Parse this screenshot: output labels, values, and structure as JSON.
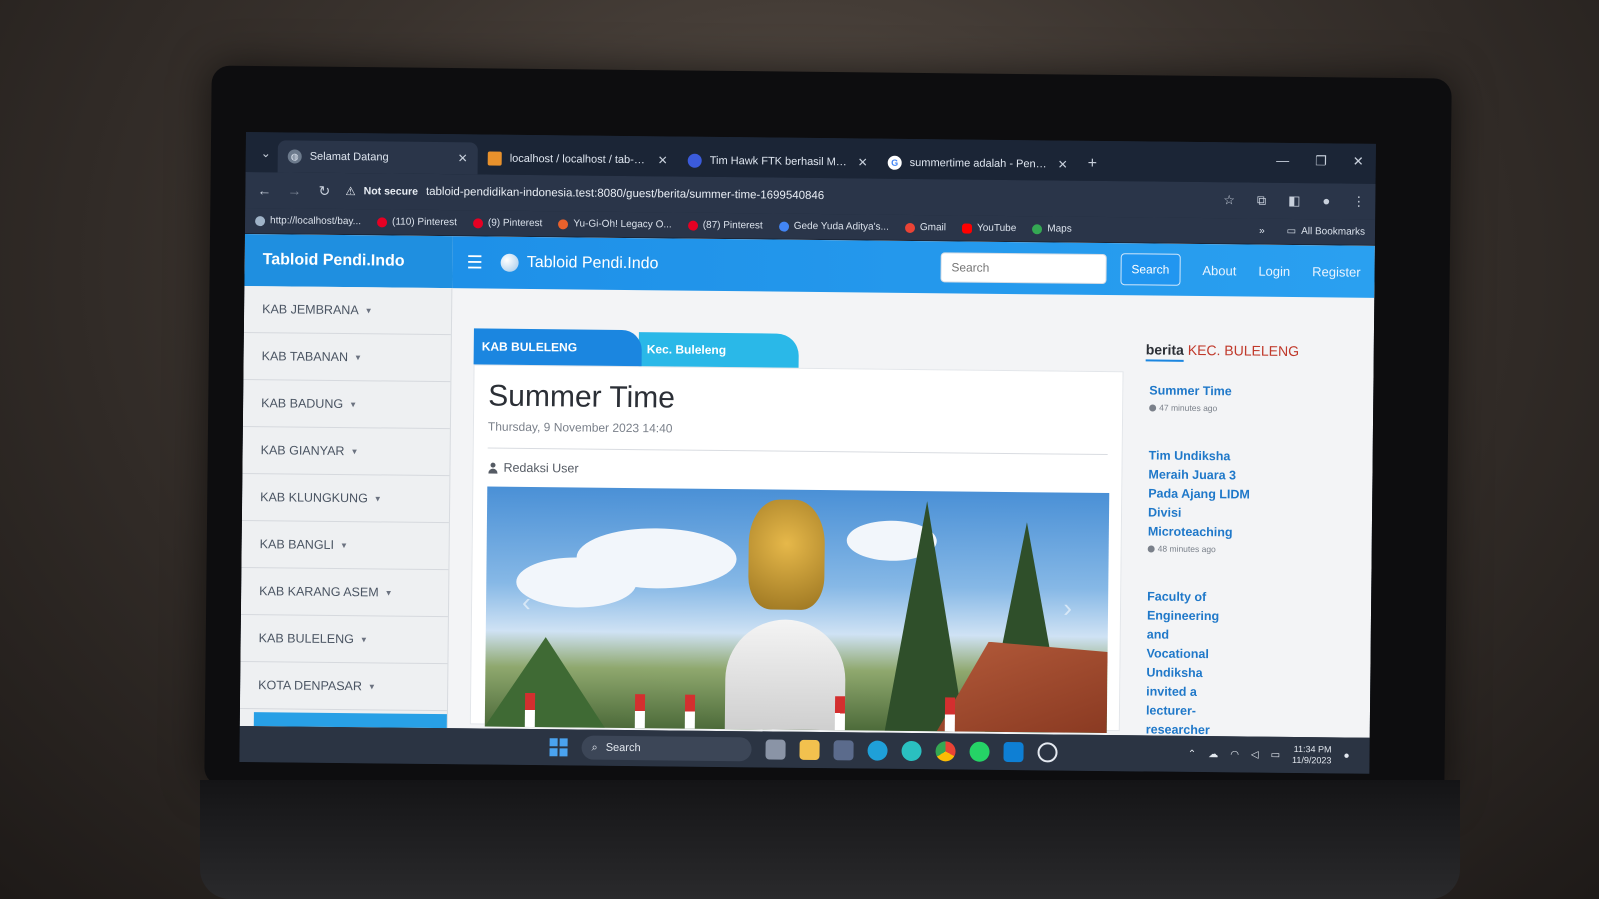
{
  "browser": {
    "tabs": [
      {
        "title": "Selamat Datang",
        "active": true
      },
      {
        "title": "localhost / localhost / tab-pen",
        "active": false
      },
      {
        "title": "Tim Hawk FTK berhasil Meraih",
        "active": false
      },
      {
        "title": "summertime adalah - Penelus",
        "active": false
      }
    ],
    "security": "Not secure",
    "url": "tabloid-pendidikan-indonesia.test:8080/guest/berita/summer-time-1699540846",
    "bookmarks": [
      {
        "label": "http://localhost/bay...",
        "color": "#9fb3c8"
      },
      {
        "label": "(110) Pinterest",
        "color": "#e60023"
      },
      {
        "label": "(9) Pinterest",
        "color": "#e60023"
      },
      {
        "label": "Yu-Gi-Oh! Legacy O...",
        "color": "#e8612c"
      },
      {
        "label": "(87) Pinterest",
        "color": "#e60023"
      },
      {
        "label": "Gede Yuda Aditya's...",
        "color": "#4285f4"
      },
      {
        "label": "Gmail",
        "color": "#ea4335"
      },
      {
        "label": "YouTube",
        "color": "#ff0000"
      },
      {
        "label": "Maps",
        "color": "#34a853"
      }
    ],
    "all_bookmarks": "All Bookmarks"
  },
  "site": {
    "brand": "Tabloid Pendi.Indo",
    "nav_title": "Tabloid Pendi.Indo",
    "search_placeholder": "Search",
    "search_button": "Search",
    "links": [
      "About",
      "Login",
      "Register"
    ]
  },
  "sidebar": {
    "items": [
      "KAB JEMBRANA",
      "KAB TABANAN",
      "KAB BADUNG",
      "KAB GIANYAR",
      "KAB KLUNGKUNG",
      "KAB BANGLI",
      "KAB KARANG ASEM",
      "KAB BULELENG",
      "KOTA DENPASAR"
    ]
  },
  "article": {
    "tag_kab": "KAB BULELENG",
    "tag_kec": "Kec. Buleleng",
    "title": "Summer Time",
    "date": "Thursday, 9 November 2023 14:40",
    "author": "Redaksi User"
  },
  "related": {
    "heading_prefix": "berita",
    "heading_region": "KEC. BULELENG",
    "items": [
      {
        "title": "Summer Time",
        "time": "47 minutes ago"
      },
      {
        "title": "Tim Undiksha Meraih Juara 3 Pada Ajang LIDM Divisi Microteaching",
        "time": "48 minutes ago"
      },
      {
        "title": "Faculty of Engineering and Vocational Undiksha invited a lecturer-researcher",
        "time": ""
      }
    ]
  },
  "taskbar": {
    "search": "Search",
    "time": "11:34 PM",
    "date": "11/9/2023"
  },
  "colors": {
    "primary": "#1b86e0",
    "accent": "#2ab8e8",
    "region_red": "#c0392b"
  }
}
